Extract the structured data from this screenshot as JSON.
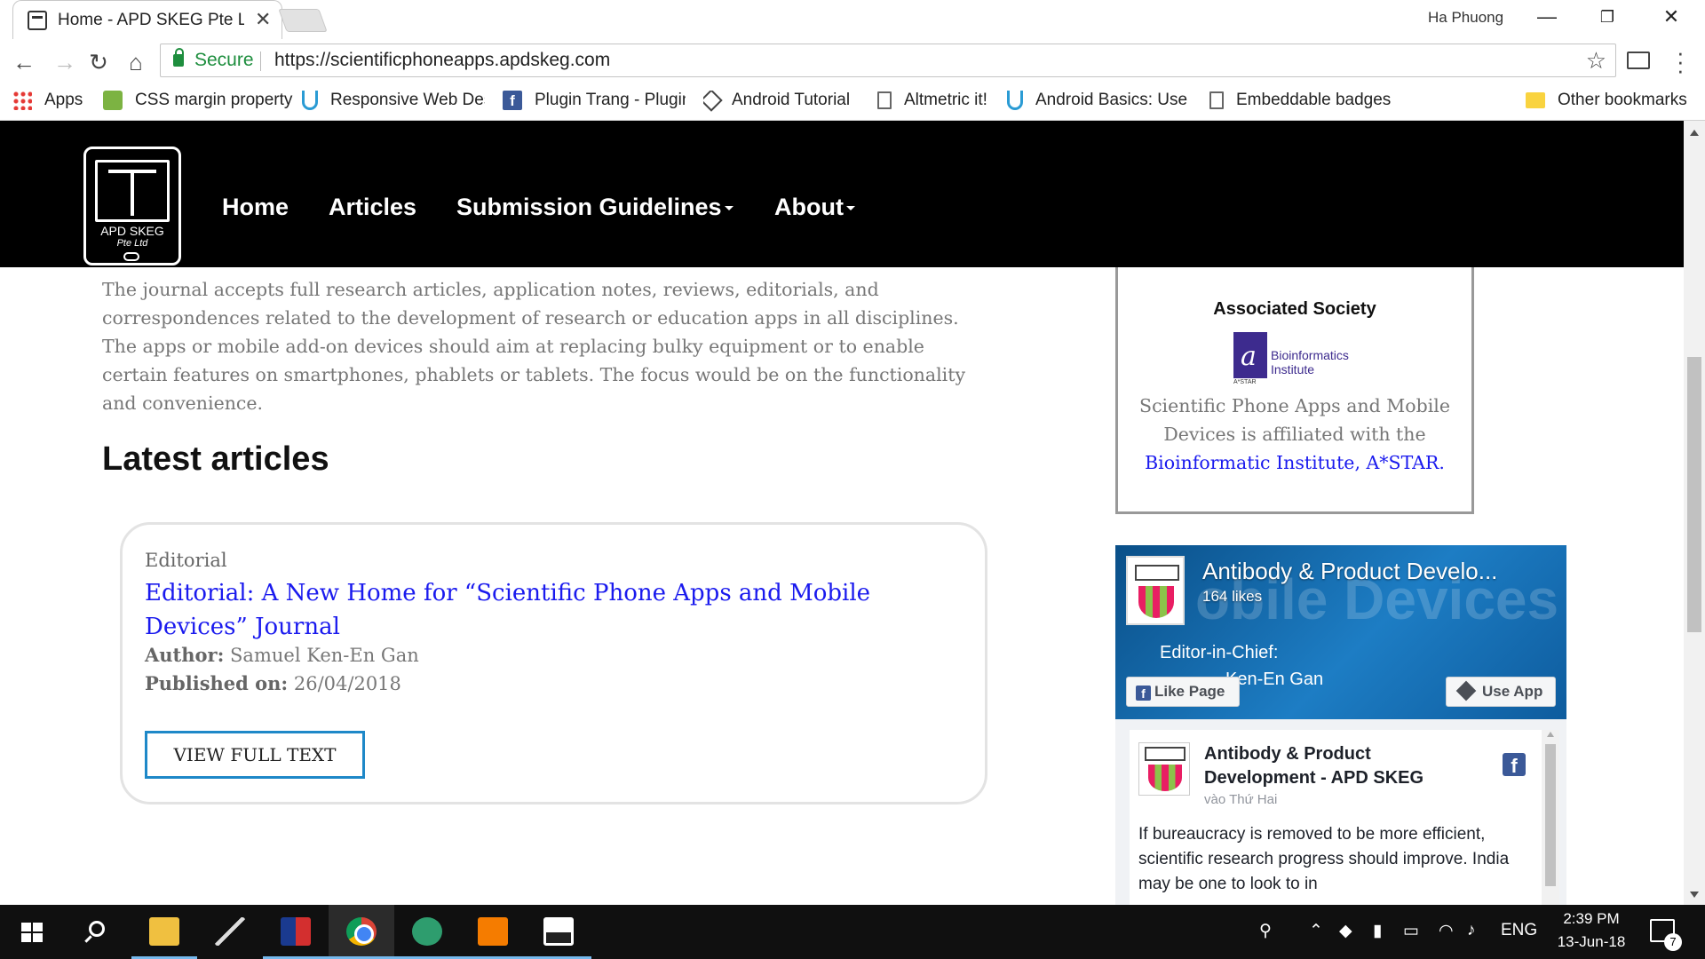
{
  "browser": {
    "tab_title": "Home - APD SKEG Pte Ltd",
    "profile_name": "Ha Phuong",
    "secure_label": "Secure",
    "url": "https://scientificphoneapps.apdskeg.com",
    "bookmarks": [
      {
        "label": "Apps",
        "icon": "apps-grid-icon"
      },
      {
        "label": "CSS margin property",
        "icon": "w3schools-icon"
      },
      {
        "label": "Responsive Web Des",
        "icon": "udacity-icon"
      },
      {
        "label": "Plugin Trang - Plugin",
        "icon": "facebook-icon"
      },
      {
        "label": "Android Tutorial",
        "icon": "diamond-icon"
      },
      {
        "label": "Altmetric it!",
        "icon": "page-icon"
      },
      {
        "label": "Android Basics: User",
        "icon": "udacity-icon"
      },
      {
        "label": "Embeddable badges",
        "icon": "page-icon"
      }
    ],
    "other_bookmarks": "Other bookmarks"
  },
  "site": {
    "logo_line1": "APD SKEG",
    "logo_line2": "Pte Ltd",
    "nav": {
      "home": "Home",
      "articles": "Articles",
      "submission": "Submission Guidelines",
      "about": "About"
    },
    "intro": "The journal accepts full research articles, application notes, reviews, editorials, and correspondences related to the development of research or education apps in all disciplines. The apps or mobile add-on devices should aim at replacing bulky equipment or to enable certain features on smartphones, phablets or tablets. The focus would be on the functionality and convenience.",
    "latest_heading": "Latest articles",
    "article": {
      "category": "Editorial",
      "title": "Editorial: A New Home for “Scientific Phone Apps and Mobile Devices” Journal",
      "author_label": "Author:",
      "author": "Samuel Ken-En Gan",
      "published_label": "Published on:",
      "published": "26/04/2018",
      "button": "VIEW FULL TEXT"
    },
    "society": {
      "title": "Associated Society",
      "logo_name_line1": "Bioinformatics",
      "logo_name_line2": "Institute",
      "logo_subtext": "A*STAR",
      "text": "Scientific Phone Apps and Mobile Devices is affiliated with the",
      "link": "Bioinformatic Institute, A*STAR."
    },
    "facebook": {
      "page_name": "Antibody & Product Develo...",
      "likes": "164 likes",
      "cover_big_text": "obile Devices",
      "cover_editor": "Editor-in-Chief:",
      "cover_editor_name": "Ken-En Gan",
      "like_button": "Like Page",
      "use_app_button": "Use App",
      "post_title": "Antibody & Product Development - APD SKEG",
      "post_time": "vào Thứ Hai",
      "post_text": "If bureaucracy is removed to be more efficient, scientific research progress should improve. India may be one to look to in"
    }
  },
  "taskbar": {
    "tray_lang": "ENG",
    "time": "2:39 PM",
    "date": "13-Jun-18",
    "notification_count": "7"
  }
}
